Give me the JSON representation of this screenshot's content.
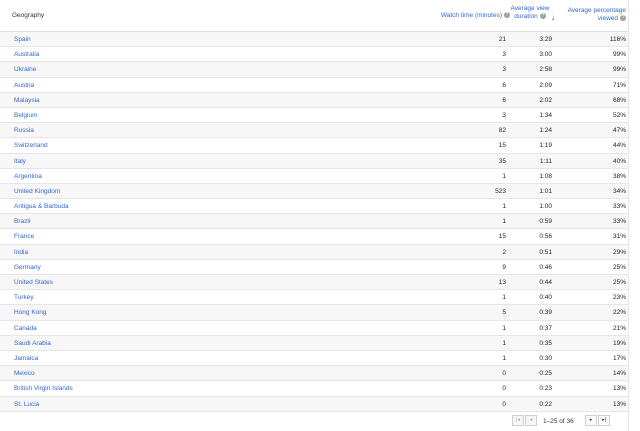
{
  "header": {
    "geography": "Geography",
    "watch_time": "Watch time (minutes)",
    "avg_view_duration": "Average view dura­tion",
    "avg_percentage_viewed": "Average per­centage viewed",
    "help_glyph": "?",
    "sort_glyph": "↓"
  },
  "rows": [
    {
      "geo": "Spain",
      "watch": "21",
      "avd": "3:29",
      "avp": "116%"
    },
    {
      "geo": "Australia",
      "watch": "3",
      "avd": "3:00",
      "avp": "99%"
    },
    {
      "geo": "Ukraine",
      "watch": "3",
      "avd": "2:58",
      "avp": "99%"
    },
    {
      "geo": "Austria",
      "watch": "6",
      "avd": "2:09",
      "avp": "71%"
    },
    {
      "geo": "Malaysia",
      "watch": "6",
      "avd": "2:02",
      "avp": "68%"
    },
    {
      "geo": "Belgium",
      "watch": "3",
      "avd": "1:34",
      "avp": "52%"
    },
    {
      "geo": "Russia",
      "watch": "82",
      "avd": "1:24",
      "avp": "47%"
    },
    {
      "geo": "Switzerland",
      "watch": "15",
      "avd": "1:19",
      "avp": "44%"
    },
    {
      "geo": "Italy",
      "watch": "35",
      "avd": "1:11",
      "avp": "40%"
    },
    {
      "geo": "Argentina",
      "watch": "1",
      "avd": "1:08",
      "avp": "38%"
    },
    {
      "geo": "United Kingdom",
      "watch": "523",
      "avd": "1:01",
      "avp": "34%"
    },
    {
      "geo": "Antigua & Barbuda",
      "watch": "1",
      "avd": "1:00",
      "avp": "33%"
    },
    {
      "geo": "Brazil",
      "watch": "1",
      "avd": "0:59",
      "avp": "33%"
    },
    {
      "geo": "France",
      "watch": "15",
      "avd": "0:56",
      "avp": "31%"
    },
    {
      "geo": "India",
      "watch": "2",
      "avd": "0:51",
      "avp": "29%"
    },
    {
      "geo": "Germany",
      "watch": "9",
      "avd": "0:46",
      "avp": "25%"
    },
    {
      "geo": "United States",
      "watch": "13",
      "avd": "0:44",
      "avp": "25%"
    },
    {
      "geo": "Turkey",
      "watch": "1",
      "avd": "0:40",
      "avp": "23%"
    },
    {
      "geo": "Hong Kong",
      "watch": "5",
      "avd": "0:39",
      "avp": "22%"
    },
    {
      "geo": "Canada",
      "watch": "1",
      "avd": "0:37",
      "avp": "21%"
    },
    {
      "geo": "Saudi Arabia",
      "watch": "1",
      "avd": "0:35",
      "avp": "19%"
    },
    {
      "geo": "Jamaica",
      "watch": "1",
      "avd": "0:30",
      "avp": "17%"
    },
    {
      "geo": "Mexico",
      "watch": "0",
      "avd": "0:25",
      "avp": "14%"
    },
    {
      "geo": "British Virgin Islands",
      "watch": "0",
      "avd": "0:23",
      "avp": "13%"
    },
    {
      "geo": "St. Lucia",
      "watch": "0",
      "avd": "0:22",
      "avp": "13%"
    }
  ],
  "pager": {
    "range": "1–25 of",
    "total": "36",
    "first_glyph": "|◂",
    "prev_glyph": "◂",
    "next_glyph": "▸",
    "last_glyph": "▸|"
  },
  "colors": {
    "link": "#3366cc",
    "zebra": "#f7f7f7",
    "border": "#e6e6e6"
  }
}
